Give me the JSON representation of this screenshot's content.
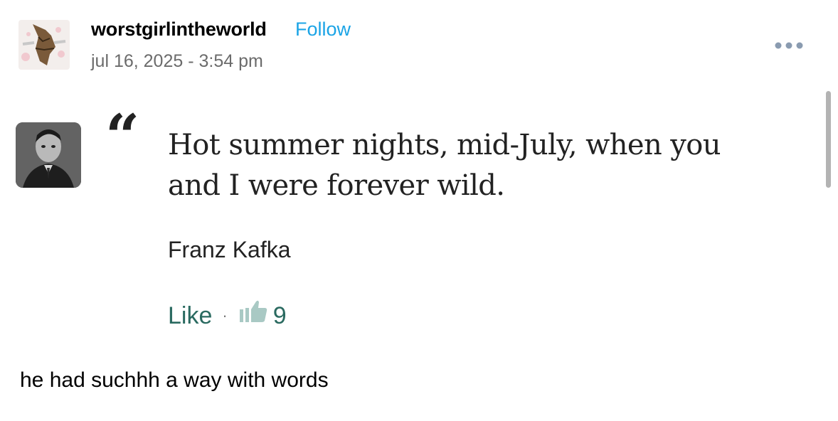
{
  "post": {
    "username": "worstgirlintheworld",
    "follow_label": "Follow",
    "timestamp": "jul 16, 2025 - 3:54 pm",
    "more_icon": "more-horizontal-icon"
  },
  "quote_card": {
    "quote_mark": "“",
    "quote_lines": [
      "Hot summer nights, mid-July, when you",
      "and I were forever wild."
    ],
    "author": "Franz Kafka",
    "like_label": "Like",
    "separator": "·",
    "thumbs_icon": "thumbs-up-icon",
    "like_count": "9",
    "like_color": "#2a6a60"
  },
  "caption": "he had suchhh a way with words",
  "colors": {
    "follow": "#1ba4e6",
    "timestamp": "#6b6b6b",
    "menu_dots": "#8a9bb0"
  }
}
